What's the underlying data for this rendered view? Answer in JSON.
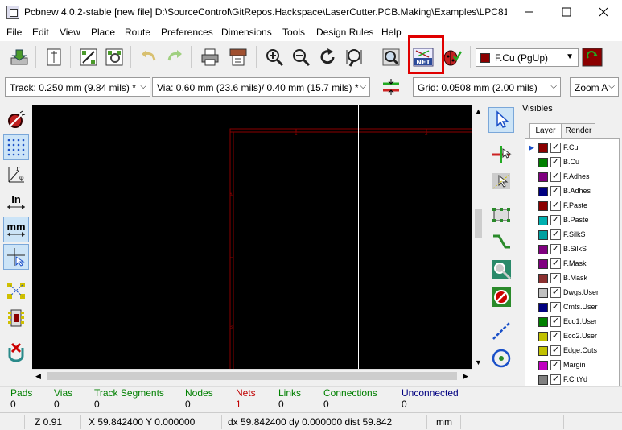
{
  "window": {
    "title": "Pcbnew 4.0.2-stable  [new file] D:\\SourceControl\\GitRepos.Hackspace\\LaserCutter.PCB.Making\\Examples\\LPC81..."
  },
  "menu": [
    "File",
    "Edit",
    "View",
    "Place",
    "Route",
    "Preferences",
    "Dimensions",
    "Tools",
    "Design Rules",
    "Help"
  ],
  "toolbar": {
    "active_layer": "F.Cu (PgUp)",
    "active_layer_color": "#8b0000",
    "netlist_button_label": "NET",
    "highlight_color": "#e00000"
  },
  "toolbar2": {
    "track": "Track: 0.250 mm (9.84 mils) *",
    "via": "Via: 0.60 mm (23.6 mils)/ 0.40 mm (15.7 mils) *",
    "grid": "Grid: 0.0508 mm (2.00 mils)",
    "zoom": "Zoom A"
  },
  "left_toolbar": {
    "inch_label": "In",
    "mm_label": "mm"
  },
  "canvas": {
    "background": "#000000",
    "frame_color": "#8b0000",
    "cursor_color": "#ffffff",
    "frame_labels": [
      "1",
      "2",
      "A",
      "B"
    ]
  },
  "visibles": {
    "title": "Visibles",
    "tabs": [
      "Layer",
      "Render"
    ],
    "layers": [
      {
        "name": "F.Cu",
        "color": "#8b0000",
        "checked": true,
        "active": true
      },
      {
        "name": "B.Cu",
        "color": "#008000",
        "checked": true
      },
      {
        "name": "F.Adhes",
        "color": "#800080",
        "checked": true
      },
      {
        "name": "B.Adhes",
        "color": "#000080",
        "checked": true
      },
      {
        "name": "F.Paste",
        "color": "#8b0000",
        "checked": true
      },
      {
        "name": "B.Paste",
        "color": "#00b0b0",
        "checked": true
      },
      {
        "name": "F.SilkS",
        "color": "#00a0a0",
        "checked": true
      },
      {
        "name": "B.SilkS",
        "color": "#800080",
        "checked": true
      },
      {
        "name": "F.Mask",
        "color": "#800080",
        "checked": true
      },
      {
        "name": "B.Mask",
        "color": "#8b3030",
        "checked": true
      },
      {
        "name": "Dwgs.User",
        "color": "#c0c0c0",
        "checked": true
      },
      {
        "name": "Cmts.User",
        "color": "#000080",
        "checked": true
      },
      {
        "name": "Eco1.User",
        "color": "#008000",
        "checked": true
      },
      {
        "name": "Eco2.User",
        "color": "#c0c000",
        "checked": true
      },
      {
        "name": "Edge.Cuts",
        "color": "#c0c000",
        "checked": true
      },
      {
        "name": "Margin",
        "color": "#c000c0",
        "checked": true
      },
      {
        "name": "F.CrtYd",
        "color": "#808080",
        "checked": true
      }
    ]
  },
  "message_panel": [
    {
      "label": "Pads",
      "value": "0",
      "value_color": "#000000"
    },
    {
      "label": "Vias",
      "value": "0",
      "value_color": "#000000"
    },
    {
      "label": "Track Segments",
      "value": "0",
      "value_color": "#000000"
    },
    {
      "label": "Nodes",
      "value": "0",
      "value_color": "#000000"
    },
    {
      "label": "Nets",
      "value": "1",
      "value_color": "#c00000",
      "label_color": "#c00000"
    },
    {
      "label": "Links",
      "value": "0",
      "value_color": "#000000"
    },
    {
      "label": "Connections",
      "value": "0",
      "value_color": "#000000"
    },
    {
      "label": "Unconnected",
      "value": "0",
      "value_color": "#000000",
      "label_color": "#000080"
    }
  ],
  "status": {
    "zoom": "Z 0.91",
    "abs": "X 59.842400  Y 0.000000",
    "rel": "dx 59.842400  dy 0.000000  dist 59.842",
    "units": "mm"
  }
}
